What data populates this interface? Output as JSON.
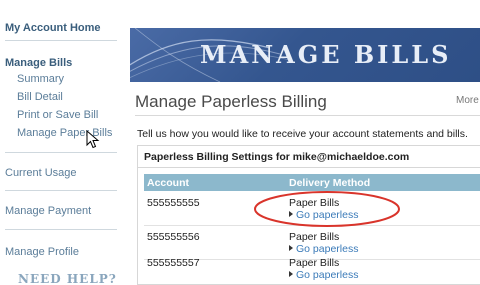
{
  "sidebar": {
    "home": "My Account Home",
    "bills_section": "Manage Bills",
    "bills_items": [
      "Summary",
      "Bill Detail",
      "Print or Save Bill",
      "Manage Paper Bills"
    ],
    "current_usage": "Current Usage",
    "manage_payment": "Manage Payment",
    "manage_profile": "Manage Profile",
    "need_help": "NEED HELP?"
  },
  "banner": {
    "title": "MANAGE BILLS"
  },
  "page": {
    "title": "Manage Paperless Billing",
    "more": "More",
    "intro": "Tell us how you would like to receive your account statements and bills."
  },
  "settings": {
    "label": "Paperless Billing Settings for mike@michaeldoe.com",
    "columns": {
      "account": "Account",
      "delivery": "Delivery Method"
    },
    "rows": [
      {
        "account": "555555555",
        "method": "Paper Bills",
        "action": "Go paperless"
      },
      {
        "account": "555555556",
        "method": "Paper Bills",
        "action": "Go paperless"
      },
      {
        "account": "555555557",
        "method": "Paper Bills",
        "action": "Go paperless"
      }
    ]
  },
  "colors": {
    "banner": "#34568f",
    "table_header": "#8cb8cc",
    "link": "#3a7ab8",
    "highlight_oval": "#d9342b"
  }
}
